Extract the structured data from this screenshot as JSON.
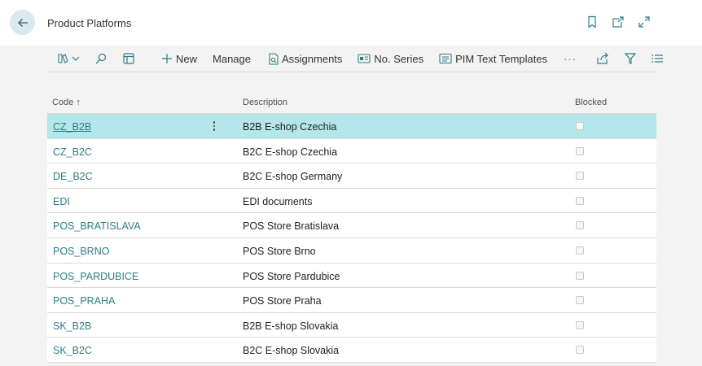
{
  "header": {
    "title": "Product Platforms",
    "back_icon": "arrow-left-icon",
    "actions": [
      "bookmark-icon",
      "open-new-window-icon",
      "expand-icon"
    ]
  },
  "toolbar": {
    "items": [
      {
        "name": "search-icon"
      },
      {
        "name": "filter-pane-icon"
      }
    ],
    "new_label": "New",
    "manage_label": "Manage",
    "assignments_label": "Assignments",
    "no_series_label": "No. Series",
    "pim_label": "PIM Text Templates",
    "more_label": "···"
  },
  "grid": {
    "headers": {
      "code": "Code ↑",
      "description": "Description",
      "blocked": "Blocked"
    },
    "rows": [
      {
        "code": "CZ_B2B",
        "description": "B2B E-shop Czechia",
        "blocked": false,
        "selected": true
      },
      {
        "code": "CZ_B2C",
        "description": "B2C E-shop Czechia",
        "blocked": false
      },
      {
        "code": "DE_B2C",
        "description": "B2C E-shop Germany",
        "blocked": false
      },
      {
        "code": "EDI",
        "description": "EDI documents",
        "blocked": false
      },
      {
        "code": "POS_BRATISLAVA",
        "description": "POS Store Bratislava",
        "blocked": false
      },
      {
        "code": "POS_BRNO",
        "description": "POS Store Brno",
        "blocked": false
      },
      {
        "code": "POS_PARDUBICE",
        "description": "POS Store Pardubice",
        "blocked": false
      },
      {
        "code": "POS_PRAHA",
        "description": "POS Store Praha",
        "blocked": false
      },
      {
        "code": "SK_B2B",
        "description": "B2B E-shop Slovakia",
        "blocked": false
      },
      {
        "code": "SK_B2C",
        "description": "B2C E-shop Slovakia",
        "blocked": false
      }
    ]
  },
  "colors": {
    "accent_link": "#2c7f87",
    "selected_row": "#b3e7ea",
    "back_button_bg": "#d9e9ee"
  }
}
